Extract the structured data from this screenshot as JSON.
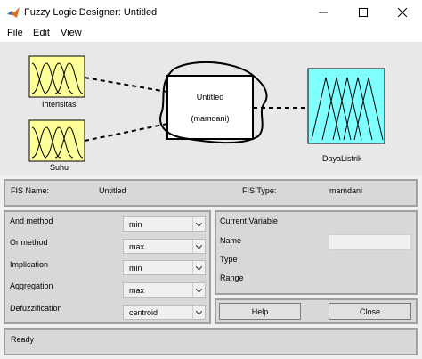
{
  "window": {
    "title": "Fuzzy Logic Designer: Untitled"
  },
  "menu": [
    "File",
    "Edit",
    "View"
  ],
  "diagram": {
    "inputs": [
      "Intensitas",
      "Suhu"
    ],
    "system_name": "Untitled",
    "system_type": "(mamdani)",
    "output": "DayaListrik"
  },
  "fis": {
    "name_label": "FIS Name:",
    "name_value": "Untitled",
    "type_label": "FIS Type:",
    "type_value": "mamdani"
  },
  "methods": [
    {
      "label": "And method",
      "value": "min"
    },
    {
      "label": "Or method",
      "value": "max"
    },
    {
      "label": "Implication",
      "value": "min"
    },
    {
      "label": "Aggregation",
      "value": "max"
    },
    {
      "label": "Defuzzification",
      "value": "centroid"
    }
  ],
  "current_variable": {
    "title": "Current Variable",
    "name_label": "Name",
    "type_label": "Type",
    "range_label": "Range"
  },
  "buttons": {
    "help": "Help",
    "close": "Close"
  },
  "status": "Ready",
  "colors": {
    "input_fill": "#ffff99",
    "output_fill": "#80ffff"
  }
}
